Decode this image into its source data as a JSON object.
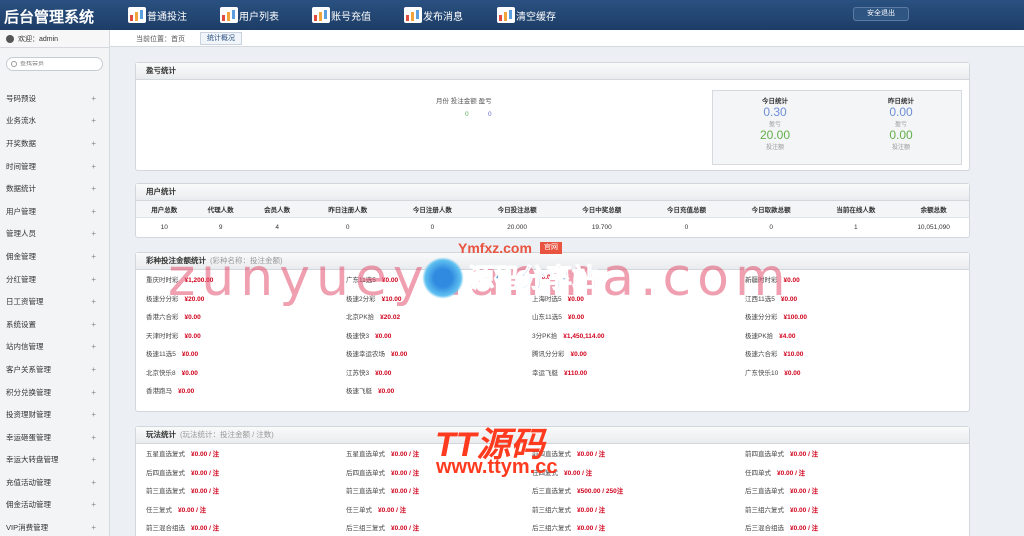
{
  "header": {
    "app_title": "后台管理系统",
    "nav": [
      "普通投注",
      "用户列表",
      "账号充值",
      "发布消息",
      "清空缓存"
    ],
    "logout_label": "安全退出"
  },
  "sidebar": {
    "user_label": "欢迎：admin",
    "search_placeholder": "查找会员",
    "items": [
      "号码预设",
      "业务流水",
      "开奖数据",
      "时间管理",
      "数据统计",
      "用户管理",
      "管理人员",
      "佣金管理",
      "分红管理",
      "日工资管理",
      "系统设置",
      "站内信管理",
      "客户关系管理",
      "积分兑换管理",
      "投资理财管理",
      "幸运砸蛋管理",
      "幸运大转盘管理",
      "充值活动管理",
      "佣金活动管理",
      "VIP消费管理"
    ]
  },
  "breadcrumb": {
    "location": "当前位置：首页",
    "tab": "统计概况"
  },
  "profit": {
    "title": "盈亏统计",
    "legend": "月份 投注金额 盈亏",
    "legend_values": [
      "0",
      "0"
    ],
    "today": {
      "title": "今日统计",
      "profit": "0.30",
      "profit_label": "盈亏",
      "bets": "20.00",
      "bets_label": "投注额"
    },
    "yesterday": {
      "title": "昨日统计",
      "profit": "0.00",
      "profit_label": "盈亏",
      "bets": "0.00",
      "bets_label": "投注额"
    }
  },
  "users": {
    "title": "用户统计",
    "columns": [
      "用户总数",
      "代理人数",
      "会员人数",
      "昨日注册人数",
      "今日注册人数",
      "今日投注总额",
      "今日中奖总额",
      "今日充值总额",
      "今日取款总额",
      "当前在线人数",
      "余额总数"
    ],
    "row": [
      "10",
      "9",
      "4",
      "0",
      "0",
      "20.000",
      "19.700",
      "0",
      "0",
      "1",
      "10,051,090"
    ]
  },
  "lottery": {
    "title": "彩种投注金额统计",
    "subtitle": "(彩种名称：投注金额)",
    "items": [
      [
        "重庆时时彩",
        "¥1,200.00"
      ],
      [
        "广东11选5",
        "¥0.00"
      ],
      [
        "",
        "¥0.00"
      ],
      [
        "新疆时时彩",
        "¥0.00"
      ],
      [
        "极速分分彩",
        "¥20.00"
      ],
      [
        "极速2分彩",
        "¥10.00"
      ],
      [
        "上海时选5",
        "¥0.00"
      ],
      [
        "江西11选5",
        "¥0.00"
      ],
      [
        "香港六合彩",
        "¥0.00"
      ],
      [
        "北京PK拾",
        "¥20.02"
      ],
      [
        "山东11选5",
        "¥0.00"
      ],
      [
        "极速分分彩",
        "¥100.00"
      ],
      [
        "天津时时彩",
        "¥0.00"
      ],
      [
        "极速快3",
        "¥0.00"
      ],
      [
        "3分PK拾",
        "¥1,450,114.00"
      ],
      [
        "极速PK拾",
        "¥4.00"
      ],
      [
        "极速11选5",
        "¥0.00"
      ],
      [
        "极速幸运农场",
        "¥0.00"
      ],
      [
        "腾讯分分彩",
        "¥0.00"
      ],
      [
        "极速六合彩",
        "¥10.00"
      ],
      [
        "北京快乐8",
        "¥0.00"
      ],
      [
        "江苏快3",
        "¥0.00"
      ],
      [
        "幸运飞艇",
        "¥110.00"
      ],
      [
        "广东快乐10",
        "¥0.00"
      ],
      [
        "香港跑马",
        "¥0.00"
      ],
      [
        "极速飞艇",
        "¥0.00"
      ],
      null,
      null
    ]
  },
  "play": {
    "title": "玩法统计",
    "subtitle": "(玩法统计：投注金额 / 注数)",
    "items": [
      [
        "五星直选复式",
        "¥0.00 / 注"
      ],
      [
        "五星直选单式",
        "¥0.00 / 注"
      ],
      [
        "前四直选复式",
        "¥0.00 / 注"
      ],
      [
        "前四直选单式",
        "¥0.00 / 注"
      ],
      [
        "后四直选复式",
        "¥0.00 / 注"
      ],
      [
        "后四直选单式",
        "¥0.00 / 注"
      ],
      [
        "任四复式",
        "¥0.00 / 注"
      ],
      [
        "任四单式",
        "¥0.00 / 注"
      ],
      [
        "前三直选复式",
        "¥0.00 / 注"
      ],
      [
        "前三直选单式",
        "¥0.00 / 注"
      ],
      [
        "后三直选复式",
        "¥500.00 / 250注"
      ],
      [
        "后三直选单式",
        "¥0.00 / 注"
      ],
      [
        "任三复式",
        "¥0.00 / 注"
      ],
      [
        "任三单式",
        "¥0.00 / 注"
      ],
      [
        "前三组六复式",
        "¥0.00 / 注"
      ],
      [
        "前三组六复式",
        "¥0.00 / 注"
      ],
      [
        "前三混合组选",
        "¥0.00 / 注"
      ],
      [
        "后三组三复式",
        "¥0.00 / 注"
      ],
      [
        "后三组六复式",
        "¥0.00 / 注"
      ],
      [
        "后三混合组选",
        "¥0.00 / 注"
      ]
    ]
  },
  "watermark": {
    "big": "zunyueyuanma.com",
    "site": "Ymfxz.com",
    "badge": "官网",
    "brand": "源码分享站",
    "tt": "TT源码",
    "tt_url": "www.ttym.cc"
  }
}
